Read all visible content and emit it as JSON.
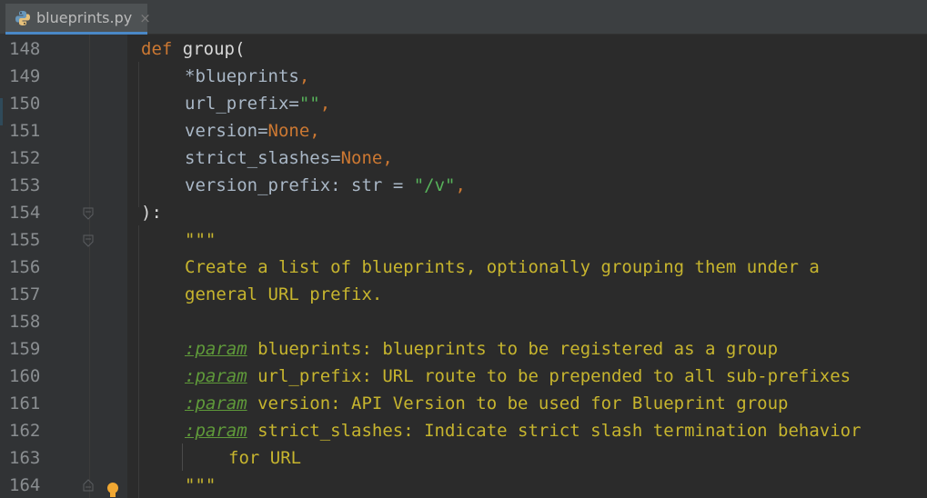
{
  "tab": {
    "file_name": "blueprints.py",
    "close_glyph": "×",
    "icon": "python-file-icon"
  },
  "colors": {
    "background": "#2b2b2b",
    "gutter": "#313335",
    "keyword": "#cc7832",
    "docstring": "#c7b52e",
    "string": "#6a8759",
    "tab_underline": "#4a88c7"
  },
  "lines": [
    {
      "num": "148"
    },
    {
      "num": "149"
    },
    {
      "num": "150"
    },
    {
      "num": "151"
    },
    {
      "num": "152"
    },
    {
      "num": "153"
    },
    {
      "num": "154"
    },
    {
      "num": "155"
    },
    {
      "num": "156"
    },
    {
      "num": "157"
    },
    {
      "num": "158"
    },
    {
      "num": "159"
    },
    {
      "num": "160"
    },
    {
      "num": "161"
    },
    {
      "num": "162"
    },
    {
      "num": "163"
    },
    {
      "num": "164"
    }
  ],
  "code": {
    "l148": {
      "kw": "def",
      "name": "group",
      "paren": "("
    },
    "l149": {
      "text": "*blueprints",
      "comma": ","
    },
    "l150": {
      "param": "url_prefix",
      "eq": "=",
      "str": "\"\"",
      "comma": ","
    },
    "l151": {
      "param": "version",
      "eq": "=",
      "val": "None",
      "comma": ","
    },
    "l152": {
      "param": "strict_slashes",
      "eq": "=",
      "val": "None",
      "comma": ","
    },
    "l153": {
      "param": "version_prefix",
      "colon": ":",
      "type": " str ",
      "eq": "=",
      "str": "\"/v\"",
      "comma": ","
    },
    "l154": {
      "text": "):"
    },
    "l155": {
      "text": "\"\"\""
    },
    "l156": {
      "text": "Create a list of blueprints, optionally grouping them under a"
    },
    "l157": {
      "text": "general URL prefix."
    },
    "l158": {
      "text": ""
    },
    "l159": {
      "tag": ":param",
      "text": " blueprints: blueprints to be registered as a group"
    },
    "l160": {
      "tag": ":param",
      "text": " url_prefix: URL route to be prepended to all sub-prefixes"
    },
    "l161": {
      "tag": ":param",
      "text": " version: API Version to be used for Blueprint group"
    },
    "l162": {
      "tag": ":param",
      "text": " strict_slashes: Indicate strict slash termination behavior"
    },
    "l163": {
      "text": "for URL"
    },
    "l164": {
      "text": "\"\"\""
    }
  }
}
